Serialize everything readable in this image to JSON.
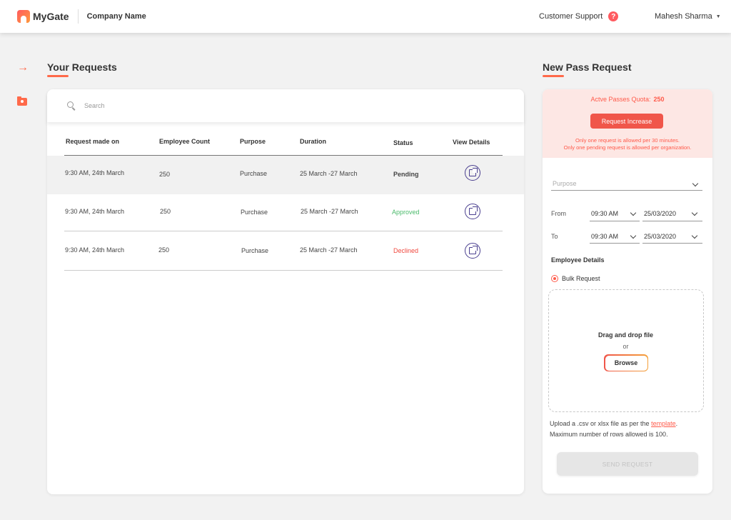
{
  "header": {
    "brand": "MyGate",
    "company": "Company Name",
    "support_label": "Customer Support",
    "help_glyph": "?",
    "user_name": "Mahesh Sharma"
  },
  "requests": {
    "title": "Your Requests",
    "search_placeholder": "Search",
    "columns": [
      "Request made on",
      "Employee Count",
      "Purpose",
      "Duration",
      "Status",
      "View Details"
    ],
    "rows": [
      {
        "date": "9:30 AM, 24th March",
        "count": "250",
        "purpose": "Purchase",
        "duration": "25 March -27 March",
        "status": "Pending"
      },
      {
        "date": "9:30 AM, 24th March",
        "count": "250",
        "purpose": "Purchase",
        "duration": "25 March -27 March",
        "status": "Approved"
      },
      {
        "date": "9:30 AM, 24th March",
        "count": "250",
        "purpose": "Purchase",
        "duration": "25 March -27 March",
        "status": "Declined"
      }
    ]
  },
  "new_pass": {
    "title": "New Pass Request",
    "quota_label": "Actve Passes Quota:",
    "quota_value": "250",
    "request_increase_label": "Request Increase",
    "notice_1": "Only one request is allowed per 30 minutes.",
    "notice_2": "Only one pending request is allowed per organization.",
    "purpose_placeholder": "Purpose",
    "from_label": "From",
    "from_time": "09:30 AM",
    "from_date": "25/03/2020",
    "to_label": "To",
    "to_time": "09:30 AM",
    "to_date": "25/03/2020",
    "employee_details_label": "Employee Details",
    "bulk_request_label": "Bulk Request",
    "drop_title": "Drag and drop file",
    "drop_or": "or",
    "browse_label": "Browse",
    "upload_note_prefix": "Upload a .csv or xlsx file as per the ",
    "template_link": "template",
    "upload_note_suffix": ".",
    "max_rows_note": "Maximum number of rows allowed is 100.",
    "send_label": "SEND REQUEST"
  },
  "colors": {
    "accent": "#ff6a4a",
    "approved": "#4cbb6c",
    "declined": "#f0483e",
    "view_icon": "#4a3f8f"
  },
  "icons": {
    "rail": [
      "arrow-right-icon",
      "folder-user-icon"
    ],
    "search": "search-icon",
    "view": "external-link-icon",
    "help": "help-circle-icon"
  }
}
